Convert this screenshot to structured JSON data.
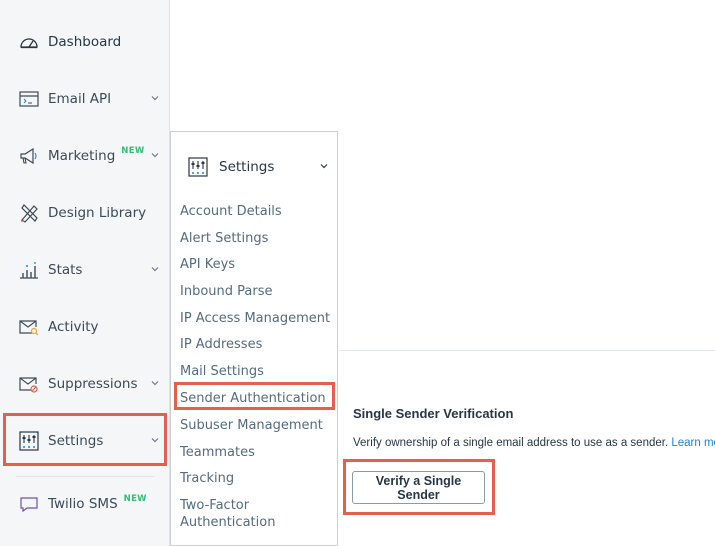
{
  "sidebar": {
    "items": [
      {
        "label": "Dashboard",
        "icon": "gauge-icon"
      },
      {
        "label": "Email API",
        "icon": "code-window-icon"
      },
      {
        "label": "Marketing",
        "badge": "NEW",
        "icon": "megaphone-icon"
      },
      {
        "label": "Design Library",
        "icon": "design-tools-icon"
      },
      {
        "label": "Stats",
        "icon": "bar-chart-icon"
      },
      {
        "label": "Activity",
        "icon": "activity-search-icon"
      },
      {
        "label": "Suppressions",
        "icon": "suppression-icon"
      },
      {
        "label": "Settings",
        "icon": "sliders-icon"
      },
      {
        "label": "Twilio SMS",
        "badge": "NEW",
        "icon": "chat-bubble-icon"
      }
    ]
  },
  "flyout": {
    "title": "Settings",
    "items": [
      "Account Details",
      "Alert Settings",
      "API Keys",
      "Inbound Parse",
      "IP Access Management",
      "IP Addresses",
      "Mail Settings",
      "Sender Authentication",
      "Subuser Management",
      "Teammates",
      "Tracking",
      "Two-Factor",
      "Authentication"
    ]
  },
  "main": {
    "single_sender": {
      "title": "Single Sender Verification",
      "description": "Verify ownership of a single email address to use as a sender.",
      "learn_more": "Learn more",
      "button_label": "Verify a Single Sender"
    }
  },
  "colors": {
    "highlight": "#e3604d",
    "new_badge": "#2fbf71",
    "link": "#1a82e2",
    "sidebar_bg": "#f4f6f8"
  }
}
